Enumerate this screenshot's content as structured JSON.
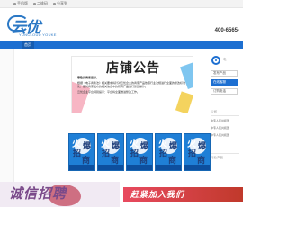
{
  "topbar": {
    "links": [
      {
        "icon": "mobile-icon",
        "label": "手机版"
      },
      {
        "icon": "qrcode-icon",
        "label": "二维码"
      },
      {
        "icon": "share-icon",
        "label": "分享到"
      }
    ]
  },
  "header": {
    "logo_text": "云优客",
    "logo_sub": "YUNCLOUD YOUKE",
    "phone": "400-6565-"
  },
  "nav": {
    "items": [
      "首页"
    ]
  },
  "announcement": {
    "title": "店铺公告",
    "greeting": "尊敬的商家您好：",
    "paragraphs": [
      "根据《电子商务法》相关要求将针对云优企业的商家产品依照行业法规进行全面的整改标准化，即对商家发布的相关信息中的所有产品进行整改操作。",
      "云优企业平台特别提示：平台将全面推进整改工作。"
    ]
  },
  "products": [
    {
      "chars": [
        "火",
        "爆",
        "招",
        "商"
      ]
    },
    {
      "chars": [
        "火",
        "爆",
        "招",
        "商"
      ]
    },
    {
      "chars": [
        "火",
        "爆",
        "招",
        "商"
      ]
    },
    {
      "chars": [
        "火",
        "爆",
        "招",
        "商"
      ]
    },
    {
      "chars": [
        "火",
        "爆",
        "招",
        "商"
      ]
    }
  ],
  "sidebar_right": {
    "name": "电",
    "btn1": "发布产品",
    "btn2": "在线客服",
    "btn3": "订购电话",
    "section_label": "公司",
    "items": [
      "中专人民共和国",
      "中专人民共和国",
      "中专人民共和国"
    ],
    "bottom_label": "行业产品"
  },
  "banners": {
    "left": "诚信招聘",
    "right": "赶紧加入我们"
  },
  "colors": {
    "nav_blue": "#1d6fd1",
    "card_blue": "#1f7fd6",
    "brand": "#2b78c5"
  }
}
